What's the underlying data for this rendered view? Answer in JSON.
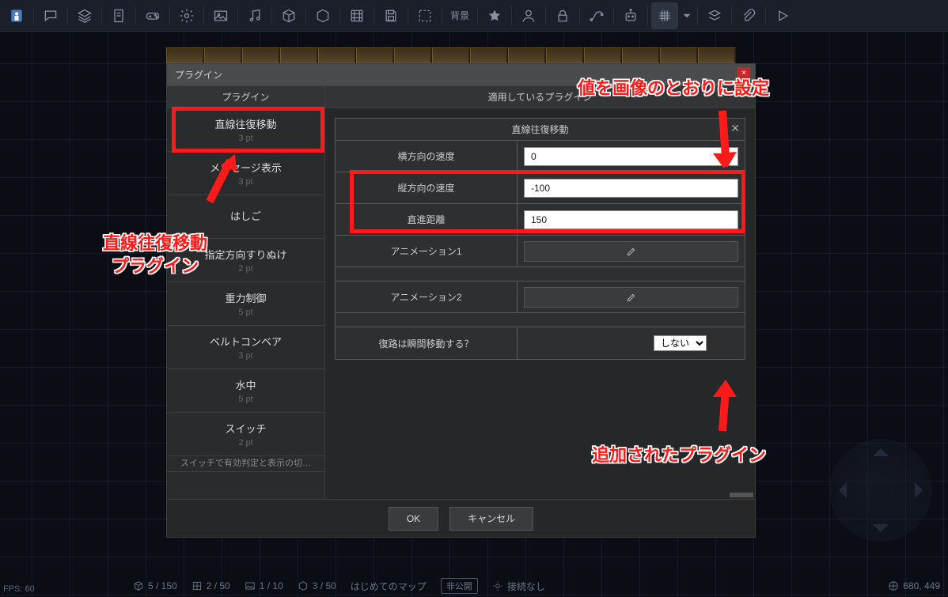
{
  "toolbar": {
    "bg_label": "背景",
    "icons": [
      "logo",
      "chat",
      "layers",
      "page",
      "gamepad",
      "gear",
      "image",
      "music",
      "cube",
      "box",
      "film",
      "save",
      "dashed",
      "bg-text",
      "star",
      "user",
      "lock",
      "path",
      "robot",
      "grid",
      "dropdown",
      "stack",
      "clip",
      "play"
    ]
  },
  "dialog": {
    "title": "プラグイン",
    "header_left": "プラグイン",
    "header_right": "適用しているプラグイン",
    "ok": "OK",
    "cancel": "キャンセル"
  },
  "plugins": [
    {
      "name": "直線往復移動",
      "pt": "3 pt"
    },
    {
      "name": "メッセージ表示",
      "pt": "3 pt"
    },
    {
      "name": "はしご",
      "pt": ""
    },
    {
      "name": "指定方向すりぬけ",
      "pt": "2 pt"
    },
    {
      "name": "重力制御",
      "pt": "5 pt"
    },
    {
      "name": "ベルトコンベア",
      "pt": "3 pt"
    },
    {
      "name": "水中",
      "pt": "5 pt"
    },
    {
      "name": "スイッチ",
      "pt": "2 pt"
    },
    {
      "name": "スイッチで有効判定と表示の切…",
      "pt": ""
    }
  ],
  "settings": {
    "title": "直線往復移動",
    "rows": {
      "h_speed_label": "横方向の速度",
      "h_speed_value": "0",
      "v_speed_label": "縦方向の速度",
      "v_speed_value": "-100",
      "distance_label": "直進距離",
      "distance_value": "150",
      "anim1_label": "アニメーション1",
      "anim2_label": "アニメーション2",
      "teleport_label": "復路は瞬間移動する？",
      "teleport_value": "しない"
    }
  },
  "annotations": {
    "top_right": "値を画像のとおりに設定",
    "left_line1": "直線往復移動",
    "left_line2": "プラグイン",
    "bottom_right": "追加されたプラグイン"
  },
  "status": {
    "cube": "5 / 150",
    "grid": "2 / 50",
    "image": "1 / 10",
    "box": "3 / 50",
    "map": "はじめてのマップ",
    "visibility": "非公開",
    "connection": "接続なし",
    "coords": "680, 449",
    "fps": "FPS: 60"
  }
}
